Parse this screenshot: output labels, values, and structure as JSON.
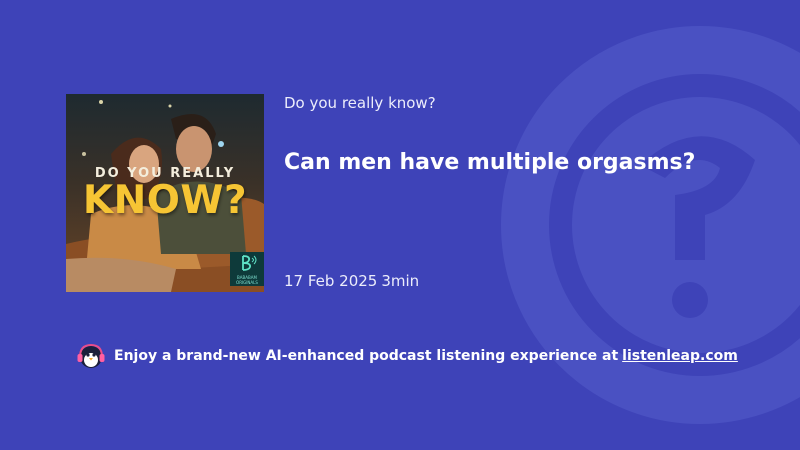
{
  "podcast": {
    "name": "Do you really know?",
    "cover": {
      "heading_small": "DO YOU REALLY",
      "heading_large": "KNOW?",
      "publisher_line1": "BABABAM",
      "publisher_line2": "ORIGINALS"
    }
  },
  "episode": {
    "title": "Can men have multiple orgasms?",
    "date": "17 Feb 2025",
    "duration": "3min"
  },
  "footer": {
    "promo_text": "Enjoy a brand-new AI-enhanced podcast listening experience at",
    "link_text": "listenleap.com"
  },
  "icons": {
    "background": "listenleap-logo-watermark",
    "mascot": "penguin-headphones-icon",
    "publisher": "bababam-logo-icon"
  },
  "colors": {
    "background": "#3e43b8",
    "watermark": "#4a51c2",
    "cover_heading": "#f6c534",
    "text": "#ffffff"
  }
}
